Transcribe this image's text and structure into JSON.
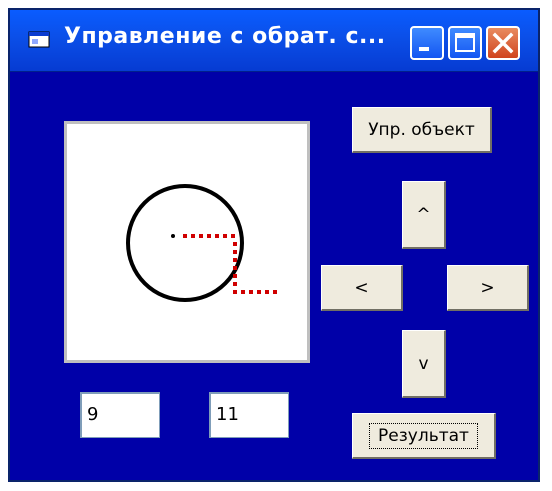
{
  "window": {
    "title": "Управление с обрат. с...",
    "controls": {
      "minimize": "minimize-icon",
      "maximize": "maximize-icon",
      "close": "close-icon"
    },
    "colors": {
      "client_background": "#0000a8",
      "titlebar": "#0b4fe8",
      "close_button": "#d0441e",
      "button_face": "#efebde"
    }
  },
  "canvas": {
    "shapes": {
      "circle_stroke": "#000000",
      "path_dots_color": "#d00000",
      "center_point_color": "#000000"
    }
  },
  "buttons": {
    "control_object": "Упр. объект",
    "up": "^",
    "left": "<",
    "right": ">",
    "down": "v",
    "result": "Результат"
  },
  "fields": {
    "x_value": "9",
    "y_value": "11"
  }
}
